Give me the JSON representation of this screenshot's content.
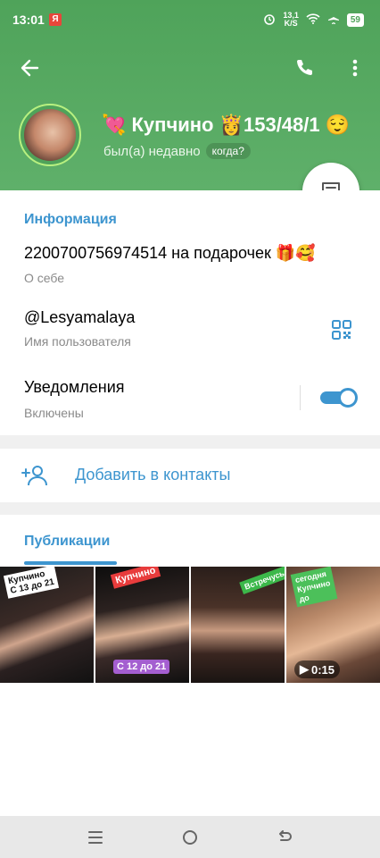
{
  "status_bar": {
    "time": "13:01",
    "carrier_badge": "Я",
    "net_speed": "13,1\nK/S",
    "battery": "59"
  },
  "profile": {
    "name": "💘 Купчино 👸153/48/1 😌",
    "last_seen": "был(а) недавно",
    "when_button": "когда?"
  },
  "info": {
    "section_title": "Информация",
    "about_value": "2200700756974514 на подарочек 🎁🥰",
    "about_label": "О себе",
    "username_value": "@Lesyamalaya",
    "username_label": "Имя пользователя",
    "notifications_value": "Уведомления",
    "notifications_label": "Включены",
    "notifications_on": true
  },
  "actions": {
    "add_contact": "Добавить в контакты"
  },
  "publications": {
    "tab_label": "Публикации",
    "items": [
      {
        "sticker": "Купчино\nС 13 до 21",
        "type": "photo"
      },
      {
        "sticker": "Купчино",
        "sticker2": "С 12 до 21",
        "type": "photo"
      },
      {
        "sticker": "Встречусь",
        "type": "photo"
      },
      {
        "sticker": "сегодня\nКупчино\nдо",
        "type": "video",
        "duration": "0:15"
      }
    ]
  },
  "colors": {
    "header_green": "#4fa35a",
    "accent_blue": "#3d95cf"
  }
}
